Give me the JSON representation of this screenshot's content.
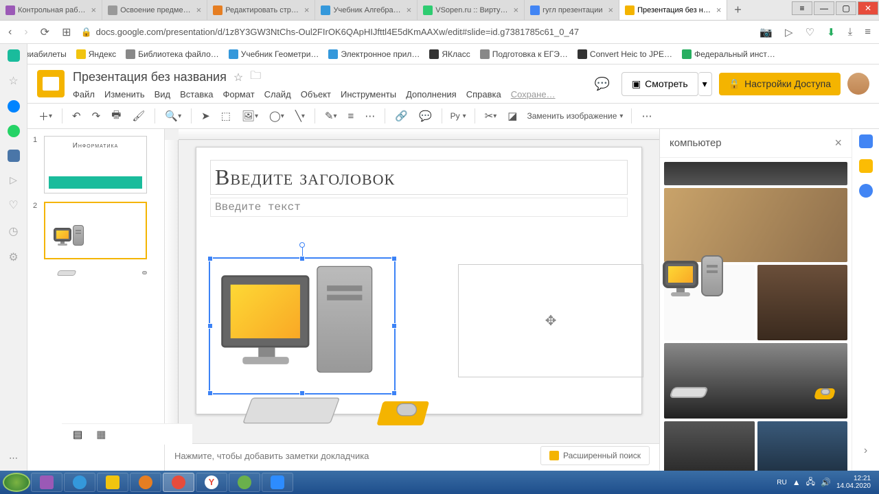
{
  "browser": {
    "tabs": [
      {
        "title": "Контрольная раб…"
      },
      {
        "title": "Освоение предме…"
      },
      {
        "title": "Редактировать стр…"
      },
      {
        "title": "Учебник Алгебра…"
      },
      {
        "title": "VSopen.ru :: Вирту…"
      },
      {
        "title": "гугл презентации"
      },
      {
        "title": "Презентация без н…"
      }
    ],
    "url": "docs.google.com/presentation/d/1z8Y3GW3NtChs-Oul2FIrOK6QApHIJfttl4E5dKmAAXw/edit#slide=id.g7381785c61_0_47"
  },
  "bookmarks": [
    "Авиабилеты",
    "Яндекс",
    "Библиотека файло…",
    "Учебник Геометри…",
    "Электронное прил…",
    "ЯКласс",
    "Подготовка к ЕГЭ…",
    "Convert Heic to JPE…",
    "Федеральный инст…"
  ],
  "doc": {
    "title": "Презентация без названия",
    "menus": [
      "Файл",
      "Изменить",
      "Вид",
      "Вставка",
      "Формат",
      "Слайд",
      "Объект",
      "Инструменты",
      "Дополнения",
      "Справка"
    ],
    "saved": "Сохране…",
    "present": "Смотреть",
    "share": "Настройки Доступа"
  },
  "toolbar": {
    "font": "Ру",
    "replace_image": "Заменить изображение"
  },
  "thumbs": {
    "slide1_title": "Информатика"
  },
  "slide": {
    "title": "Введите заголовок",
    "text": "Введите текст"
  },
  "notes": "Нажмите, чтобы добавить заметки докладчика",
  "adv_search": "Расширенный поиск",
  "search_panel": {
    "query": "компьютер"
  },
  "tray": {
    "lang": "RU",
    "time": "12:21",
    "date": "14.04.2020"
  }
}
